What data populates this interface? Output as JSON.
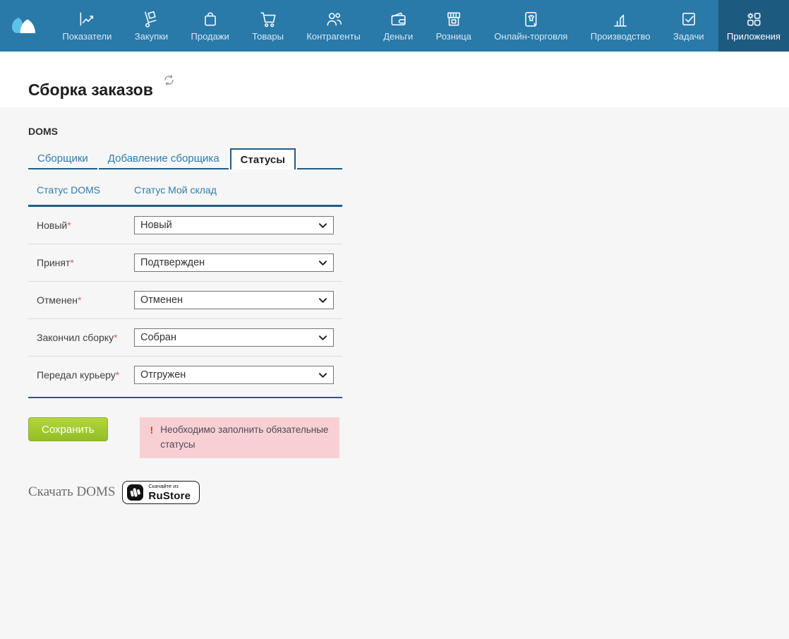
{
  "nav": {
    "items": [
      {
        "name": "indicators",
        "label": "Показатели",
        "icon": "chart-icon"
      },
      {
        "name": "purchases",
        "label": "Закупки",
        "icon": "handtruck-icon"
      },
      {
        "name": "sales",
        "label": "Продажи",
        "icon": "bag-icon"
      },
      {
        "name": "goods",
        "label": "Товары",
        "icon": "cart-icon"
      },
      {
        "name": "counterparties",
        "label": "Контрагенты",
        "icon": "people-icon"
      },
      {
        "name": "money",
        "label": "Деньги",
        "icon": "wallet-icon"
      },
      {
        "name": "retail",
        "label": "Розница",
        "icon": "store-icon"
      },
      {
        "name": "online-trade",
        "label": "Онлайн-торговля",
        "icon": "online-store-icon"
      },
      {
        "name": "production",
        "label": "Производство",
        "icon": "production-icon"
      },
      {
        "name": "tasks",
        "label": "Задачи",
        "icon": "tasks-check-icon"
      },
      {
        "name": "apps",
        "label": "Приложения",
        "icon": "apps-grid-icon",
        "active": true
      }
    ]
  },
  "page": {
    "title": "Сборка заказов"
  },
  "app": {
    "name": "DOMS",
    "tabs": [
      {
        "label": "Сборщики"
      },
      {
        "label": "Добавление сборщика"
      },
      {
        "label": "Статусы",
        "active": true
      }
    ],
    "columns": {
      "left": "Статус DOMS",
      "right": "Статус Мой склад"
    },
    "rows": [
      {
        "label": "Новый",
        "required": "*",
        "value": "Новый"
      },
      {
        "label": "Принят",
        "required": "*",
        "value": "Подтвержден"
      },
      {
        "label": "Отменен",
        "required": "*",
        "value": "Отменен"
      },
      {
        "label": "Закончил сборку",
        "required": "*",
        "value": "Собран"
      },
      {
        "label": "Передал курьеру",
        "required": "*",
        "value": "Отгружен"
      }
    ],
    "save_label": "Сохранить",
    "error": {
      "icon": "!",
      "text": "Необходимо заполнить обязательные статусы"
    },
    "download": {
      "text": "Скачать DOMS",
      "badge_small": "Скачайте из",
      "badge_brand": "RuStore"
    }
  },
  "colors": {
    "nav_bg": "#2979a9",
    "nav_active_bg": "#1d5a80",
    "link_blue": "#2e7cab",
    "dark_line": "#1f5e86",
    "save_green": "#a3cb31",
    "error_bg": "#f8d0d4",
    "error_red": "#e8312a",
    "required_red": "#e05a5a",
    "content_bg": "#f6f6f6"
  }
}
